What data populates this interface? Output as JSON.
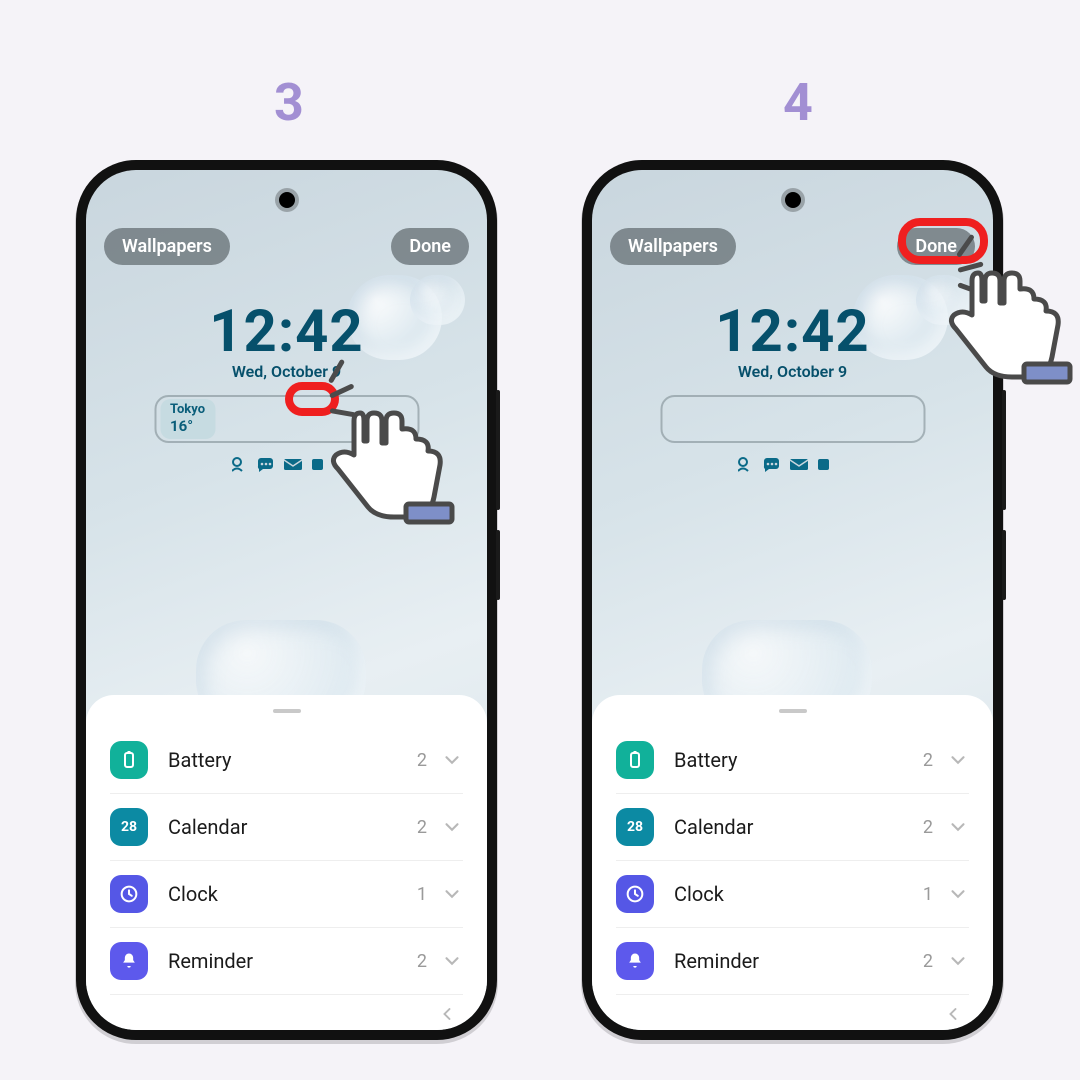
{
  "steps": {
    "left": "3",
    "right": "4"
  },
  "buttons": {
    "wallpapers": "Wallpapers",
    "done": "Done"
  },
  "clock": {
    "time": "12:42",
    "date": "Wed, October 9"
  },
  "weather": {
    "city": "Tokyo",
    "temp": "16°"
  },
  "mini_icons": "✕ ☹ 💬 ✉ ⬜",
  "widgets": [
    {
      "name": "Battery",
      "count": "2",
      "icon": "battery"
    },
    {
      "name": "Calendar",
      "count": "2",
      "icon": "cal"
    },
    {
      "name": "Clock",
      "count": "1",
      "icon": "clk"
    },
    {
      "name": "Reminder",
      "count": "2",
      "icon": "rem"
    }
  ],
  "calendar_day": "28"
}
